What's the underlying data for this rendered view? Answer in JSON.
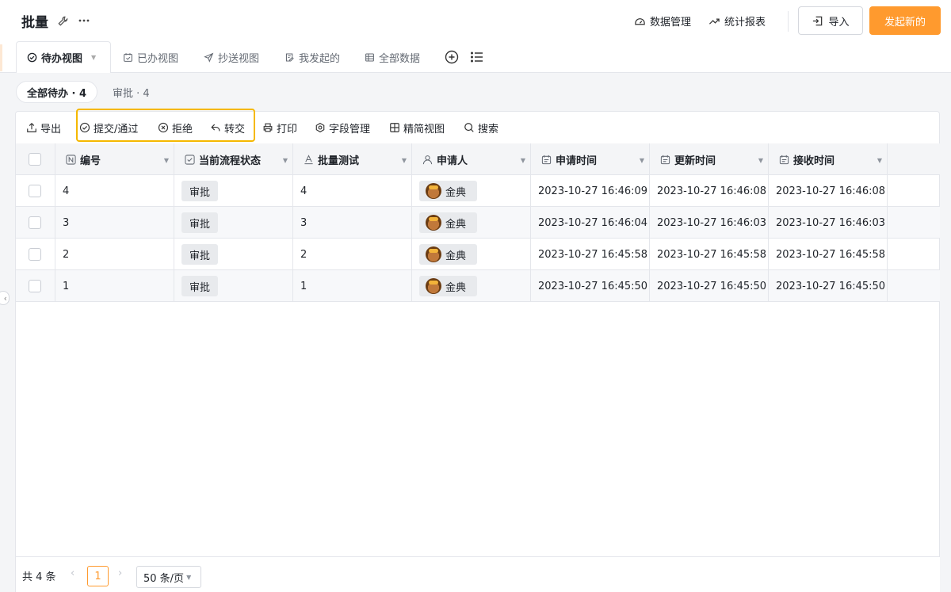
{
  "header": {
    "title": "批量",
    "data_manage": "数据管理",
    "stats_report": "统计报表",
    "import": "导入",
    "new": "发起新的"
  },
  "tabs": [
    {
      "label": "待办视图",
      "icon": "check-circle-icon",
      "active": true
    },
    {
      "label": "已办视图",
      "icon": "calendar-check-icon"
    },
    {
      "label": "抄送视图",
      "icon": "send-icon"
    },
    {
      "label": "我发起的",
      "icon": "edit-doc-icon"
    },
    {
      "label": "全部数据",
      "icon": "grid-table-icon"
    }
  ],
  "filters": {
    "all_todo": "全部待办 · 4",
    "approval": "审批 · 4"
  },
  "toolbar": {
    "export": "导出",
    "submit": "提交/通过",
    "reject": "拒绝",
    "transfer": "转交",
    "print": "打印",
    "fields": "字段管理",
    "compact": "精简视图",
    "search": "搜索"
  },
  "table": {
    "columns": [
      "编号",
      "当前流程状态",
      "批量测试",
      "申请人",
      "申请时间",
      "更新时间",
      "接收时间"
    ],
    "rows": [
      {
        "id": "4",
        "status": "审批",
        "test": "4",
        "applicant": "金典",
        "applied": "2023-10-27 16:46:09",
        "updated": "2023-10-27 16:46:08",
        "received": "2023-10-27 16:46:08"
      },
      {
        "id": "3",
        "status": "审批",
        "test": "3",
        "applicant": "金典",
        "applied": "2023-10-27 16:46:04",
        "updated": "2023-10-27 16:46:03",
        "received": "2023-10-27 16:46:03"
      },
      {
        "id": "2",
        "status": "审批",
        "test": "2",
        "applicant": "金典",
        "applied": "2023-10-27 16:45:58",
        "updated": "2023-10-27 16:45:58",
        "received": "2023-10-27 16:45:58"
      },
      {
        "id": "1",
        "status": "审批",
        "test": "1",
        "applicant": "金典",
        "applied": "2023-10-27 16:45:50",
        "updated": "2023-10-27 16:45:50",
        "received": "2023-10-27 16:45:50"
      }
    ]
  },
  "footer": {
    "total": "共 4 条",
    "page": "1",
    "page_size": "50 条/页"
  },
  "colors": {
    "accent": "#ff9a2e",
    "highlight": "#f5b800"
  }
}
